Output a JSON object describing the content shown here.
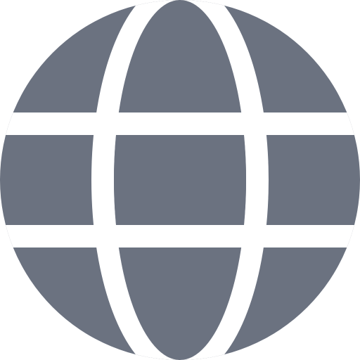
{
  "icon": {
    "name": "globe-icon",
    "fill_color": "#6b7280",
    "background_color": "#ffffff"
  }
}
